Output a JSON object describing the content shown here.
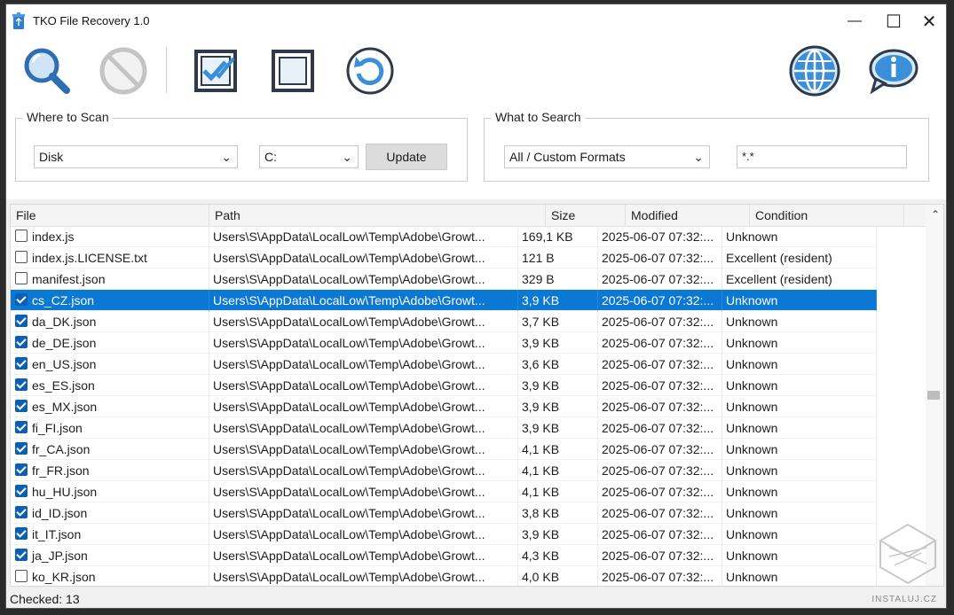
{
  "window": {
    "title": "TKO File Recovery 1.0",
    "buttons": {
      "minimize": "—",
      "maximize": "☐",
      "close": "✕"
    }
  },
  "toolbar": {
    "buttons": [
      {
        "icon": "search-icon"
      },
      {
        "icon": "stop-icon"
      },
      {
        "icon": "check-all-icon"
      },
      {
        "icon": "uncheck-all-icon"
      },
      {
        "icon": "refresh-icon"
      },
      {
        "icon": "globe-icon"
      },
      {
        "icon": "info-icon"
      }
    ]
  },
  "where_to_scan": {
    "label": "Where to Scan",
    "source": "Disk",
    "drive": "C:",
    "update": "Update"
  },
  "what_to_search": {
    "label": "What to Search",
    "format": "All / Custom Formats",
    "mask": "*.*"
  },
  "table": {
    "columns": [
      "File",
      "Path",
      "Size",
      "Modified",
      "Condition"
    ],
    "rows": [
      {
        "checked": false,
        "file": "index.js",
        "path": "Users\\S\\AppData\\LocalLow\\Temp\\Adobe\\Growt...",
        "size": "169,1 KB",
        "modified": "2025-06-07 07:32:...",
        "condition": "Unknown"
      },
      {
        "checked": false,
        "file": "index.js.LICENSE.txt",
        "path": "Users\\S\\AppData\\LocalLow\\Temp\\Adobe\\Growt...",
        "size": "121 B",
        "modified": "2025-06-07 07:32:...",
        "condition": "Excellent (resident)"
      },
      {
        "checked": false,
        "file": "manifest.json",
        "path": "Users\\S\\AppData\\LocalLow\\Temp\\Adobe\\Growt...",
        "size": "329 B",
        "modified": "2025-06-07 07:32:...",
        "condition": "Excellent (resident)"
      },
      {
        "checked": true,
        "selected": true,
        "file": "cs_CZ.json",
        "path": "Users\\S\\AppData\\LocalLow\\Temp\\Adobe\\Growt...",
        "size": "3,9 KB",
        "modified": "2025-06-07 07:32:...",
        "condition": "Unknown"
      },
      {
        "checked": true,
        "file": "da_DK.json",
        "path": "Users\\S\\AppData\\LocalLow\\Temp\\Adobe\\Growt...",
        "size": "3,7 KB",
        "modified": "2025-06-07 07:32:...",
        "condition": "Unknown"
      },
      {
        "checked": true,
        "file": "de_DE.json",
        "path": "Users\\S\\AppData\\LocalLow\\Temp\\Adobe\\Growt...",
        "size": "3,9 KB",
        "modified": "2025-06-07 07:32:...",
        "condition": "Unknown"
      },
      {
        "checked": true,
        "file": "en_US.json",
        "path": "Users\\S\\AppData\\LocalLow\\Temp\\Adobe\\Growt...",
        "size": "3,6 KB",
        "modified": "2025-06-07 07:32:...",
        "condition": "Unknown"
      },
      {
        "checked": true,
        "file": "es_ES.json",
        "path": "Users\\S\\AppData\\LocalLow\\Temp\\Adobe\\Growt...",
        "size": "3,9 KB",
        "modified": "2025-06-07 07:32:...",
        "condition": "Unknown"
      },
      {
        "checked": true,
        "file": "es_MX.json",
        "path": "Users\\S\\AppData\\LocalLow\\Temp\\Adobe\\Growt...",
        "size": "3,9 KB",
        "modified": "2025-06-07 07:32:...",
        "condition": "Unknown"
      },
      {
        "checked": true,
        "file": "fi_FI.json",
        "path": "Users\\S\\AppData\\LocalLow\\Temp\\Adobe\\Growt...",
        "size": "3,9 KB",
        "modified": "2025-06-07 07:32:...",
        "condition": "Unknown"
      },
      {
        "checked": true,
        "file": "fr_CA.json",
        "path": "Users\\S\\AppData\\LocalLow\\Temp\\Adobe\\Growt...",
        "size": "4,1 KB",
        "modified": "2025-06-07 07:32:...",
        "condition": "Unknown"
      },
      {
        "checked": true,
        "file": "fr_FR.json",
        "path": "Users\\S\\AppData\\LocalLow\\Temp\\Adobe\\Growt...",
        "size": "4,1 KB",
        "modified": "2025-06-07 07:32:...",
        "condition": "Unknown"
      },
      {
        "checked": true,
        "file": "hu_HU.json",
        "path": "Users\\S\\AppData\\LocalLow\\Temp\\Adobe\\Growt...",
        "size": "4,1 KB",
        "modified": "2025-06-07 07:32:...",
        "condition": "Unknown"
      },
      {
        "checked": true,
        "file": "id_ID.json",
        "path": "Users\\S\\AppData\\LocalLow\\Temp\\Adobe\\Growt...",
        "size": "3,8 KB",
        "modified": "2025-06-07 07:32:...",
        "condition": "Unknown"
      },
      {
        "checked": true,
        "file": "it_IT.json",
        "path": "Users\\S\\AppData\\LocalLow\\Temp\\Adobe\\Growt...",
        "size": "3,9 KB",
        "modified": "2025-06-07 07:32:...",
        "condition": "Unknown"
      },
      {
        "checked": true,
        "file": "ja_JP.json",
        "path": "Users\\S\\AppData\\LocalLow\\Temp\\Adobe\\Growt...",
        "size": "4,3 KB",
        "modified": "2025-06-07 07:32:...",
        "condition": "Unknown"
      },
      {
        "checked": false,
        "file": "ko_KR.json",
        "path": "Users\\S\\AppData\\LocalLow\\Temp\\Adobe\\Growt...",
        "size": "4,0 KB",
        "modified": "2025-06-07 07:32:...",
        "condition": "Unknown"
      }
    ]
  },
  "status": {
    "checked": "Checked: 13"
  },
  "watermark": {
    "text": "INSTALUJ.CZ"
  },
  "colors": {
    "selection": "#0b78d4",
    "accent": "#2f6db5",
    "icon_blue": "#3a8fd8"
  }
}
